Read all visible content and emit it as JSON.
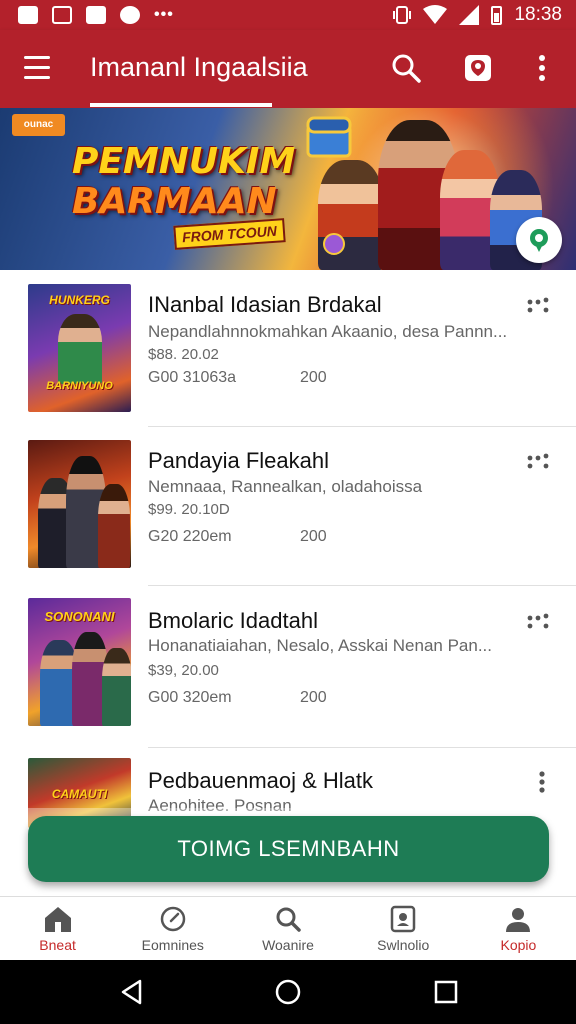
{
  "status_bar": {
    "time": "18:38",
    "left_icons": [
      "notification-icon",
      "image-icon",
      "app-icon",
      "compass-icon"
    ],
    "overflow_dots": "•••"
  },
  "app_bar": {
    "title": "Imananl Ingaalsiia",
    "icons": [
      "menu-icon",
      "search-icon",
      "shield-icon",
      "more-vert-icon"
    ]
  },
  "banner": {
    "badge": "ounac",
    "title_line1": "PEMNUKIM",
    "title_line2": "BARMAAN",
    "subtitle": "FROM TCOUN"
  },
  "list": [
    {
      "title": "INanbal Idasian Brdakal",
      "subtitle": "Nepandlahnnokmahkan Akaanio, desa Pannn...",
      "price": "$88. 20.02",
      "meta1": "G00   31063a",
      "meta2": "200",
      "thumb_title": "HUNKERG",
      "thumb_bottom": "BARNIYUNO"
    },
    {
      "title": "Pandayia Fleakahl",
      "subtitle": "Nemnaaa, Rannealkan, oladahoissa",
      "price": "$99. 20.10D",
      "meta1": "G20   220em",
      "meta2": "200",
      "thumb_title": "",
      "thumb_bottom": ""
    },
    {
      "title": "Bmolaric Idadtahl",
      "subtitle": "Honanatiaiahan, Nesalo, Asskai Nenan Pan...",
      "price": "$39, 20.00",
      "meta1": "G00   320em",
      "meta2": "200",
      "thumb_title": "SONONANI",
      "thumb_bottom": ""
    },
    {
      "title": "Pedbauenmaoj & Hlatk",
      "subtitle": "Aenohitee. Posnan",
      "price": "",
      "meta1": "",
      "meta2": "",
      "thumb_title": "CAMAUTI",
      "thumb_bottom": ""
    }
  ],
  "cta": {
    "label": "TOIMG LSEMNBAHN"
  },
  "bottom_nav": [
    {
      "label": "Bneat",
      "icon": "home-icon",
      "active": true
    },
    {
      "label": "Eomnines",
      "icon": "compass-icon",
      "active": false
    },
    {
      "label": "Woanire",
      "icon": "search-icon",
      "active": false
    },
    {
      "label": "Swlnolio",
      "icon": "portfolio-icon",
      "active": false
    },
    {
      "label": "Kopio",
      "icon": "profile-icon",
      "active": true
    }
  ],
  "system_nav": [
    "back-icon",
    "home-circle-icon",
    "recents-icon"
  ],
  "colors": {
    "primary": "#b3212b",
    "cta": "#1e7c55",
    "active_nav": "#c52a2a"
  }
}
